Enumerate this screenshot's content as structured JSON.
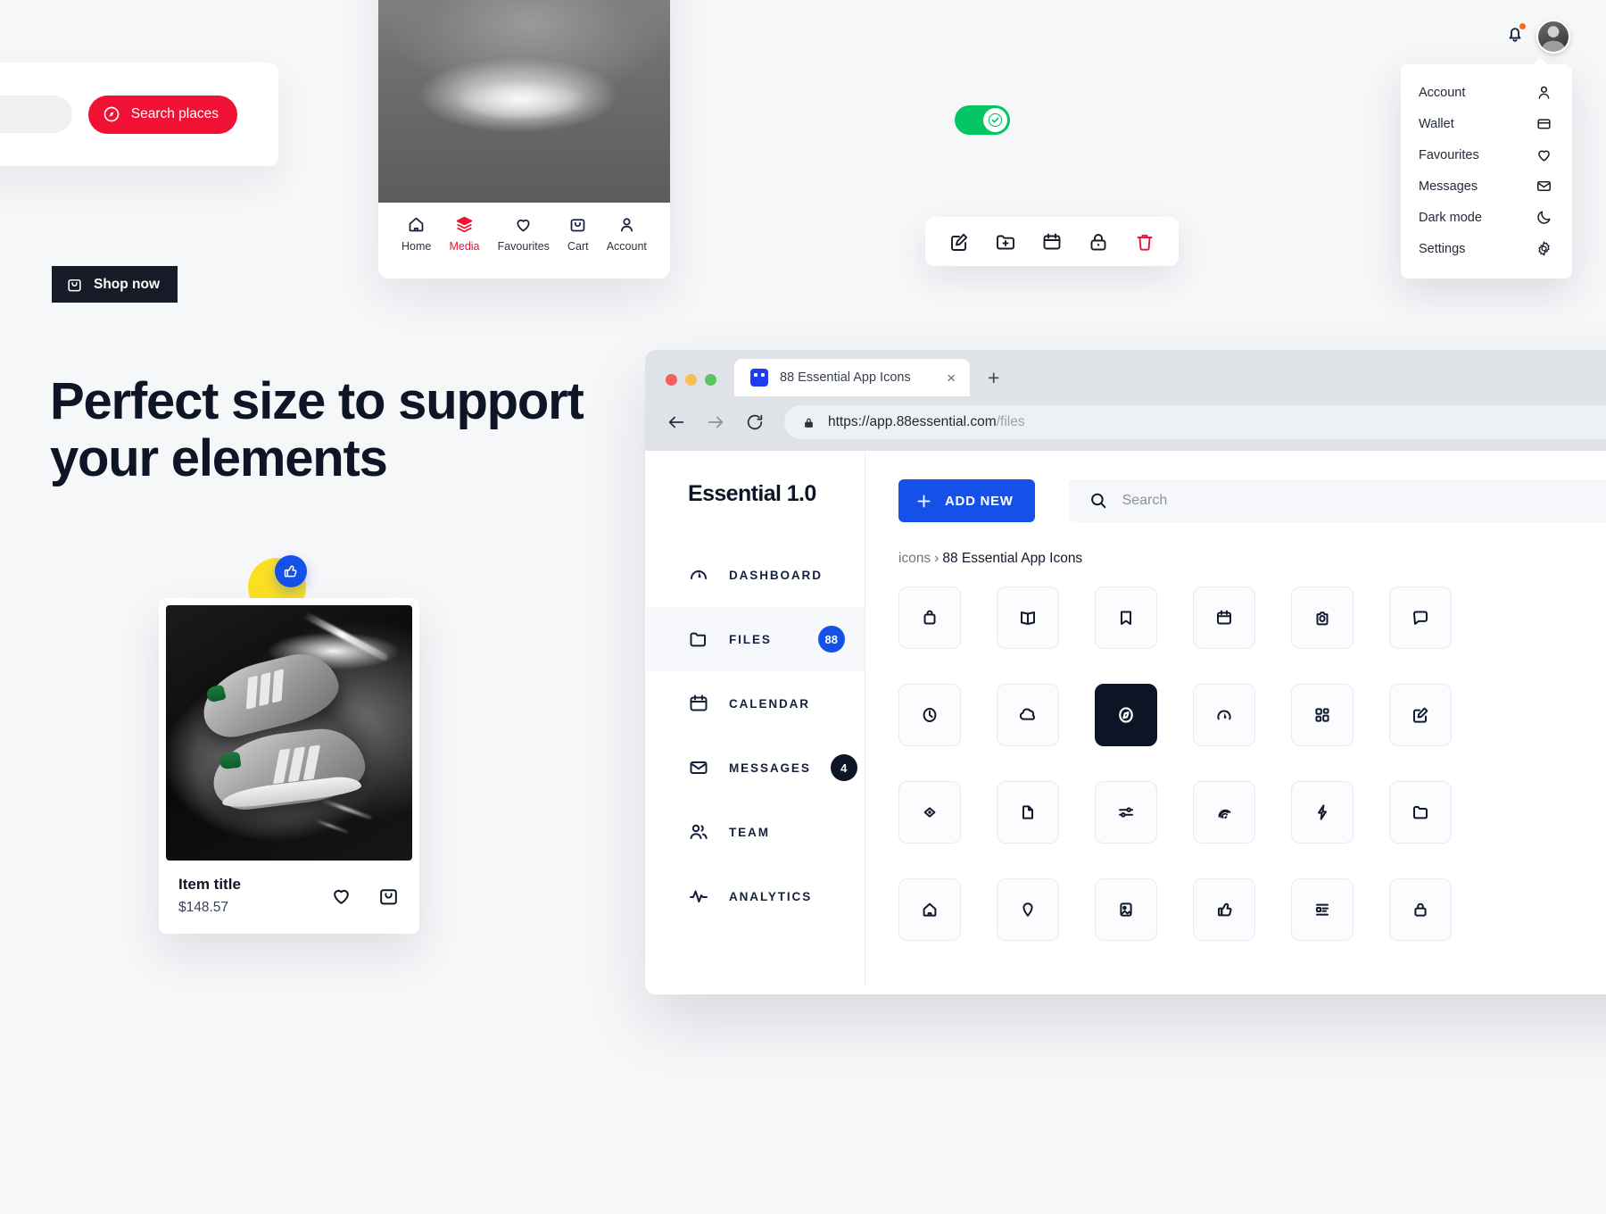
{
  "search_places": {
    "button_label": "Search places",
    "icon": "compass-icon"
  },
  "shop_now": {
    "label": "Shop now",
    "icon": "bag-icon"
  },
  "phone": {
    "nav": [
      {
        "label": "Home",
        "icon": "home-icon",
        "active": false
      },
      {
        "label": "Media",
        "icon": "layers-icon",
        "active": true
      },
      {
        "label": "Favourites",
        "icon": "heart-icon",
        "active": false
      },
      {
        "label": "Cart",
        "icon": "bag-icon",
        "active": false
      },
      {
        "label": "Account",
        "icon": "user-icon",
        "active": false
      }
    ],
    "active_color": "#f01135"
  },
  "toggle": {
    "state": "on",
    "color": "#04c563",
    "icon": "check-icon"
  },
  "action_toolbar": {
    "items": [
      {
        "name": "edit-icon",
        "danger": false
      },
      {
        "name": "folder-add-icon",
        "danger": false
      },
      {
        "name": "calendar-icon",
        "danger": false
      },
      {
        "name": "lock-icon",
        "danger": false
      },
      {
        "name": "trash-icon",
        "danger": true
      }
    ],
    "danger_color": "#f01135"
  },
  "topbar": {
    "bell_icon": "bell-icon",
    "has_notification": true,
    "notification_color": "#fd6a16",
    "avatar": "user-avatar"
  },
  "account_menu": {
    "items": [
      {
        "label": "Account",
        "icon": "user-icon"
      },
      {
        "label": "Wallet",
        "icon": "wallet-icon"
      },
      {
        "label": "Favourites",
        "icon": "heart-icon"
      },
      {
        "label": "Messages",
        "icon": "mail-icon"
      },
      {
        "label": "Dark mode",
        "icon": "moon-icon"
      },
      {
        "label": "Settings",
        "icon": "gear-icon"
      }
    ]
  },
  "headline": {
    "line1": "Perfect size to support",
    "line2": "your elements"
  },
  "product_card": {
    "title": "Item title",
    "price": "$148.57",
    "like_badge_icon": "thumbs-up-icon",
    "like_badge_color": "#1550e8",
    "blob_color": "#fbe022",
    "actions": [
      {
        "name": "heart-icon"
      },
      {
        "name": "bag-icon"
      }
    ]
  },
  "browser": {
    "tab_title": "88 Essential App Icons",
    "tab_close_label": "×",
    "new_tab_label": "+",
    "url_host": "https://app.88essential.com",
    "url_path": "/files",
    "traffic_lights": [
      "#f4615b",
      "#f6bf4f",
      "#5cc45f"
    ]
  },
  "app": {
    "brand": "Essential 1.0",
    "sidebar": [
      {
        "label": "DASHBOARD",
        "icon": "dashboard-icon",
        "badge": null,
        "badge_style": null,
        "active": false
      },
      {
        "label": "FILES",
        "icon": "folder-icon",
        "badge": "88",
        "badge_style": "blue",
        "active": true
      },
      {
        "label": "CALENDAR",
        "icon": "calendar-icon",
        "badge": null,
        "badge_style": null,
        "active": false
      },
      {
        "label": "MESSAGES",
        "icon": "mail-icon",
        "badge": "4",
        "badge_style": "dark",
        "active": false
      },
      {
        "label": "TEAM",
        "icon": "team-icon",
        "badge": null,
        "badge_style": null,
        "active": false
      },
      {
        "label": "ANALYTICS",
        "icon": "analytics-icon",
        "badge": null,
        "badge_style": null,
        "active": false
      }
    ],
    "add_new_label": "ADD NEW",
    "search_placeholder": "Search",
    "search_value": "",
    "breadcrumb": {
      "root": "icons",
      "separator": "›",
      "current": "88 Essential App Icons"
    },
    "icon_grid": [
      {
        "name": "bag-icon",
        "selected": false
      },
      {
        "name": "book-icon",
        "selected": false
      },
      {
        "name": "bookmark-icon",
        "selected": false
      },
      {
        "name": "calendar-icon",
        "selected": false
      },
      {
        "name": "camera-icon",
        "selected": false
      },
      {
        "name": "chat-icon",
        "selected": false
      },
      {
        "name": "clock-icon",
        "selected": false
      },
      {
        "name": "cloud-icon",
        "selected": false
      },
      {
        "name": "compass-icon",
        "selected": true
      },
      {
        "name": "dashboard-icon",
        "selected": false
      },
      {
        "name": "grid-icon",
        "selected": false
      },
      {
        "name": "edit-icon",
        "selected": false
      },
      {
        "name": "eye-icon",
        "selected": false
      },
      {
        "name": "file-icon",
        "selected": false
      },
      {
        "name": "filter-icon",
        "selected": false
      },
      {
        "name": "fingerprint-icon",
        "selected": false
      },
      {
        "name": "flash-icon",
        "selected": false
      },
      {
        "name": "folder-icon",
        "selected": false
      },
      {
        "name": "home-icon",
        "selected": false
      },
      {
        "name": "location-icon",
        "selected": false
      },
      {
        "name": "image-icon",
        "selected": false
      },
      {
        "name": "thumbs-up-icon",
        "selected": false
      },
      {
        "name": "list-icon",
        "selected": false
      },
      {
        "name": "lock-icon",
        "selected": false
      }
    ]
  }
}
